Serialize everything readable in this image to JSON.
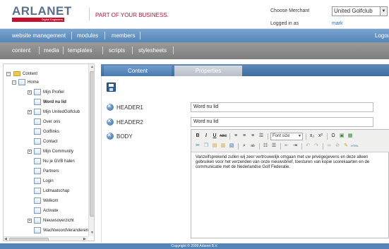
{
  "header": {
    "logo_text": "ARLANET",
    "logo_sub": "Digital Engineers",
    "tagline": "PART OF YOUR BUSINESS.",
    "merchant_label": "Choose Merchant",
    "merchant_value": "United Golfclub",
    "logged_label": "Logged in as",
    "logged_user": "mark"
  },
  "nav_primary": {
    "items": [
      "website management",
      "modules",
      "members"
    ],
    "logout": "Logout"
  },
  "nav_secondary": {
    "items": [
      "content",
      "media",
      "templates",
      "scripts",
      "stylesheets"
    ]
  },
  "tree": {
    "root": "Content",
    "home": "Home",
    "items": [
      "Mijn Profiel",
      "Word nu lid",
      "Mijn UnitedGolfclub",
      "Over ons",
      "Golflinks",
      "Contact",
      "Mijn Community",
      "Nu je GVB halen",
      "Partners",
      "Login",
      "Lidmaatschap",
      "Welkom",
      "Activate",
      "Nieuwsoverzicht",
      "WachtwoordVeranderen"
    ]
  },
  "tabs": {
    "content": "Content",
    "properties": "Properties"
  },
  "fields": {
    "header1_label": "HEADER1",
    "header1_value": "Word nu lid",
    "header2_label": "HEADER2",
    "header2_value": "Word nu lid",
    "body_label": "BODY"
  },
  "editor": {
    "fontsize_placeholder": "Font size",
    "body_text": "Vanzelfsprekend zullen wij zeer vertrouwelijk omgaan met uw privégegevens en deze alleen gebruiken voor het verzenden van onze nieuwsbrief, toesturen van kopie scorekaarten en de communicatie met de Nederlandse Golf Federatie."
  },
  "footer": {
    "text": "Copyright © 2009 Arlanet B.V."
  },
  "colors": {
    "brand_red": "#c8102e",
    "nav_blue": "#5585b8",
    "nav_gray": "#7d7d7d"
  }
}
